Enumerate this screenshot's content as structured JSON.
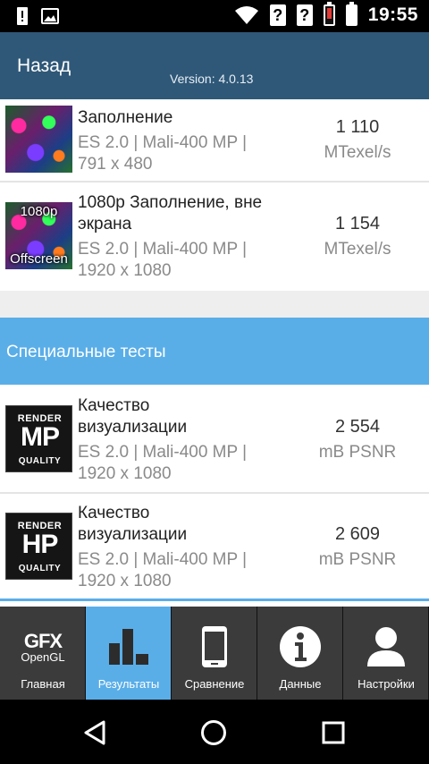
{
  "status_bar": {
    "time": "19:55",
    "icons": [
      "alert-icon",
      "image-icon",
      "wifi-icon",
      "sim-unknown-icon",
      "sim-unknown-icon",
      "battery-low-icon",
      "battery-icon"
    ],
    "q_mark": "?"
  },
  "header": {
    "back_label": "Назад",
    "version": "Version: 4.0.13"
  },
  "tests": [
    {
      "thumb_caption_top": "",
      "thumb_caption_bottom": "",
      "title": "Заполнение",
      "title2": "",
      "api": "ES 2.0 | Mali-400 MP |",
      "resolution": "791 x 480",
      "score": "1 110",
      "unit": "MTexel/s"
    },
    {
      "thumb_caption_top": "1080p",
      "thumb_caption_bottom": "Offscreen",
      "title": "1080p Заполнение, вне",
      "title2": "экрана",
      "api": "ES 2.0 | Mali-400 MP |",
      "resolution": "1920 x 1080",
      "score": "1 154",
      "unit": "MTexel/s"
    }
  ],
  "section": {
    "label": "Специальные тесты"
  },
  "special_tests": [
    {
      "badge_top": "RENDER",
      "badge_big": "MP",
      "badge_bottom": "QUALITY",
      "title": "Качество",
      "title2": "визуализации",
      "api": "ES 2.0 | Mali-400 MP |",
      "resolution": "1920 x 1080",
      "score": "2 554",
      "unit": "mB PSNR"
    },
    {
      "badge_top": "RENDER",
      "badge_big": "HP",
      "badge_bottom": "QUALITY",
      "title": "Качество",
      "title2": "визуализации",
      "api": "ES 2.0 | Mali-400 MP |",
      "resolution": "1920 x 1080",
      "score": "2 609",
      "unit": "mB PSNR"
    }
  ],
  "bottom_nav": {
    "active": "results",
    "gfx_logo_top": "GFX",
    "gfx_logo_bottom": "OpenGL",
    "items": [
      {
        "label": "Главная",
        "icon": "gfx-logo-icon"
      },
      {
        "label": "Результаты",
        "icon": "bar-chart-icon"
      },
      {
        "label": "Сравнение",
        "icon": "phone-icon"
      },
      {
        "label": "Данные",
        "icon": "info-icon"
      },
      {
        "label": "Настройки",
        "icon": "user-icon"
      }
    ]
  },
  "colors": {
    "header": "#2f5878",
    "accent": "#5aaee8",
    "nav_bg": "#3b3b3b"
  }
}
